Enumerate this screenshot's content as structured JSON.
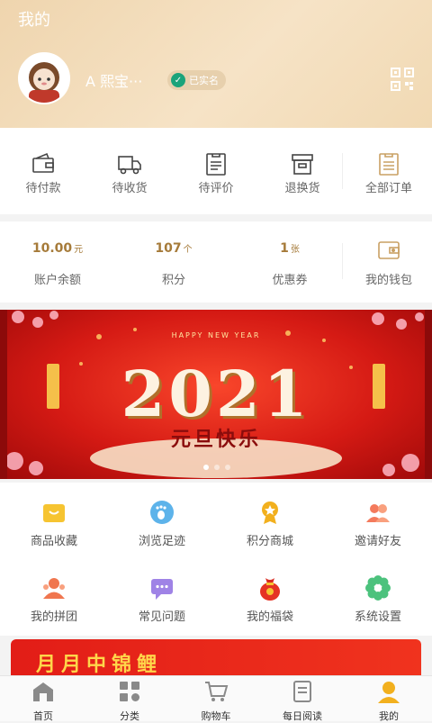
{
  "header": {
    "title": "我的",
    "username": "A 熙宝···",
    "verified_label": "已实名"
  },
  "orders": {
    "items": [
      {
        "label": "待付款",
        "icon": "wallet-icon"
      },
      {
        "label": "待收货",
        "icon": "truck-icon"
      },
      {
        "label": "待评价",
        "icon": "review-icon"
      },
      {
        "label": "退换货",
        "icon": "return-box-icon"
      },
      {
        "label": "全部订单",
        "icon": "order-list-icon"
      }
    ]
  },
  "wallet": {
    "items": [
      {
        "value": "10.00",
        "unit": "元",
        "label": "账户余额"
      },
      {
        "value": "107",
        "unit": "个",
        "label": "积分"
      },
      {
        "value": "1",
        "unit": "张",
        "label": "优惠券"
      }
    ],
    "wallet_label": "我的钱包"
  },
  "banner": {
    "headline": "2021",
    "subtitle": "元旦快乐",
    "small_text": "HAPPY NEW YEAR"
  },
  "tools": [
    {
      "label": "商品收藏",
      "icon": "favorites-icon"
    },
    {
      "label": "浏览足迹",
      "icon": "footprint-icon"
    },
    {
      "label": "积分商城",
      "icon": "points-mall-icon"
    },
    {
      "label": "邀请好友",
      "icon": "invite-friends-icon"
    },
    {
      "label": "我的拼团",
      "icon": "group-buy-icon"
    },
    {
      "label": "常见问题",
      "icon": "faq-icon"
    },
    {
      "label": "我的福袋",
      "icon": "lucky-bag-icon"
    },
    {
      "label": "系统设置",
      "icon": "settings-icon"
    }
  ],
  "promo": {
    "text": "月月中锦鲤"
  },
  "tabbar": [
    {
      "label": "首页",
      "icon": "home-icon"
    },
    {
      "label": "分类",
      "icon": "category-icon"
    },
    {
      "label": "购物车",
      "icon": "cart-icon"
    },
    {
      "label": "每日阅读",
      "icon": "daily-reading-icon"
    },
    {
      "label": "我的",
      "icon": "profile-icon"
    }
  ],
  "colors": {
    "accent": "#a67b3a",
    "header_bg": "#f2dab6",
    "banner_red": "#d51a14",
    "promo_yellow": "#ffd64a"
  }
}
